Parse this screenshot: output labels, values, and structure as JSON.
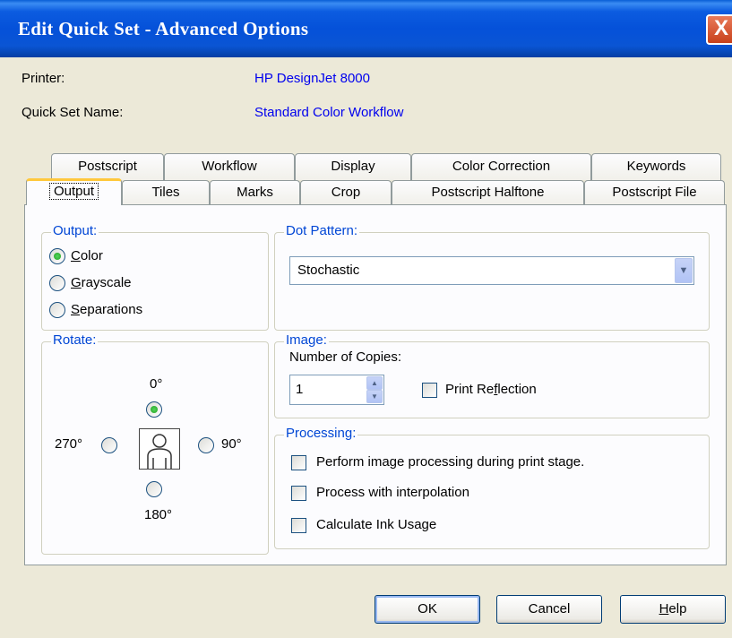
{
  "window": {
    "title": "Edit Quick Set - Advanced Options",
    "close_label": "X"
  },
  "info": {
    "printer_label": "Printer:",
    "printer_value": "HP DesignJet 8000",
    "quickset_label": "Quick Set Name:",
    "quickset_value": "Standard Color Workflow"
  },
  "tabs_back": [
    "Postscript",
    "Workflow",
    "Display",
    "Color Correction",
    "Keywords"
  ],
  "tabs_front": [
    "Output",
    "Tiles",
    "Marks",
    "Crop",
    "Postscript Halftone",
    "Postscript File"
  ],
  "selected_tab": "Output",
  "output_group": {
    "label": "Output:",
    "options": [
      {
        "label": "Color",
        "mnemonic": "C",
        "rest": "olor",
        "selected": true
      },
      {
        "label": "Grayscale",
        "mnemonic": "G",
        "rest": "rayscale",
        "selected": false
      },
      {
        "label": "Separations",
        "mnemonic": "S",
        "rest": "eparations",
        "selected": false
      }
    ]
  },
  "rotate_group": {
    "label": "Rotate:",
    "options": [
      {
        "label": "0°",
        "selected": true
      },
      {
        "label": "90°",
        "selected": false
      },
      {
        "label": "180°",
        "selected": false
      },
      {
        "label": "270°",
        "selected": false
      }
    ]
  },
  "dot_pattern": {
    "label": "Dot Pattern:",
    "selected": "Stochastic"
  },
  "image_group": {
    "label": "Image:",
    "copies_label": "Number of Copies:",
    "copies_value": "1",
    "print_reflection": {
      "label_pre": "Print Re",
      "mnemonic": "f",
      "label_post": "lection",
      "checked": false
    }
  },
  "processing_group": {
    "label": "Processing:",
    "options": [
      {
        "label": "Perform image processing during print stage.",
        "checked": false
      },
      {
        "label": "Process with interpolation",
        "checked": false
      },
      {
        "label": "Calculate Ink Usage",
        "checked": false
      }
    ]
  },
  "buttons": {
    "ok": "OK",
    "cancel": "Cancel",
    "help_mnemonic": "H",
    "help_rest": "elp"
  },
  "colors": {
    "titlebar": "#0551d9",
    "group_label": "#0046d5",
    "link_value": "#0000ee",
    "dialog_bg": "#ece9d8"
  }
}
